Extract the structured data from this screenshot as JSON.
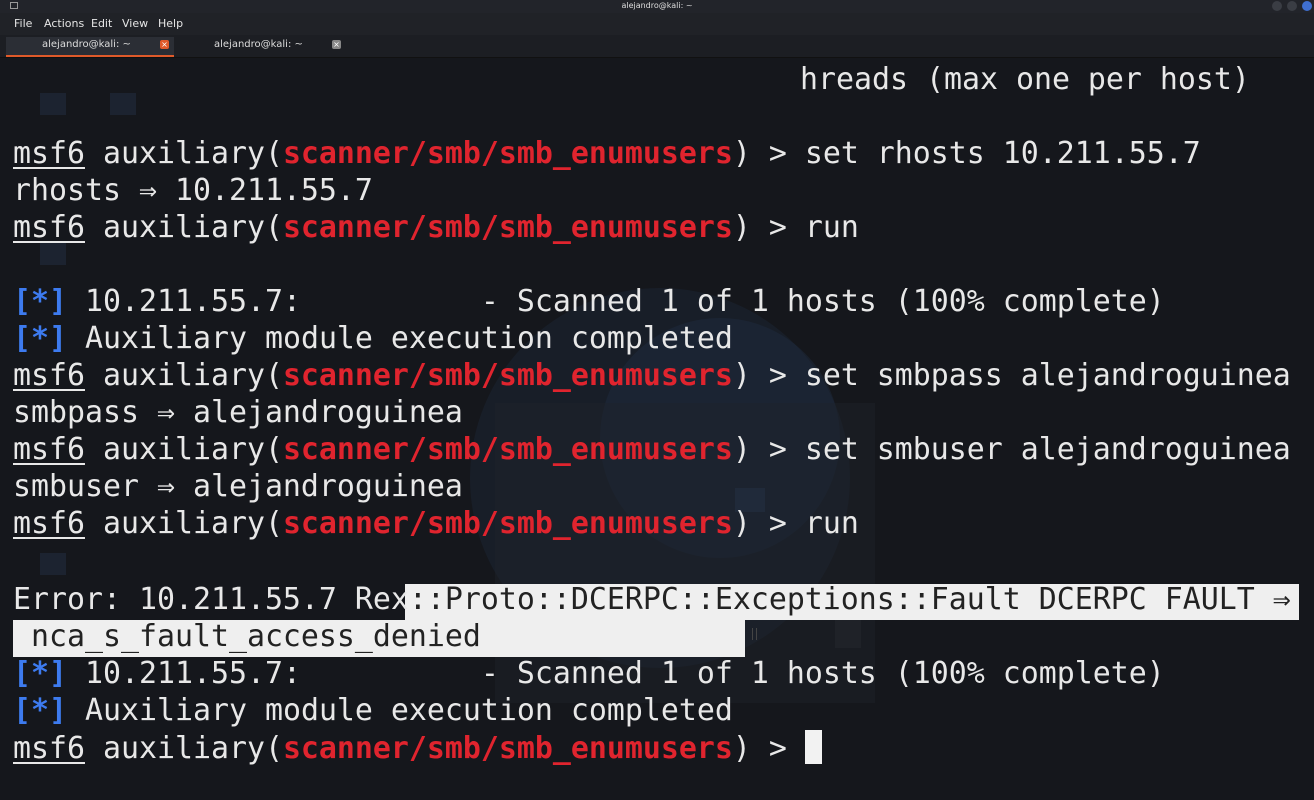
{
  "window": {
    "title": "alejandro@kali: ~"
  },
  "menu": {
    "file": "File",
    "actions": "Actions",
    "edit": "Edit",
    "view": "View",
    "help": "Help"
  },
  "tabs": [
    {
      "label": "alejandro@kali: ~"
    },
    {
      "label": "alejandro@kali: ~"
    }
  ],
  "terminal": {
    "line1": "hreads (max one per host)",
    "prompt_prefix": "msf6",
    "prompt_mid": " auxiliary(",
    "prompt_module": "scanner/smb/smb_enumusers",
    "prompt_end": ") > ",
    "cmd_set_rhosts": "set rhosts 10.211.55.7",
    "out_rhosts": "rhosts ⇒ 10.211.55.7",
    "cmd_run": "run",
    "status_marker": "[*]",
    "out_scanned": " 10.211.55.7:          - Scanned 1 of 1 hosts (100% complete)",
    "out_completed": " Auxiliary module execution completed",
    "cmd_set_smbpass": "set smbpass alejandroguinea",
    "out_smbpass": "smbpass ⇒ alejandroguinea",
    "cmd_set_smbuser": "set smbuser alejandroguinea",
    "out_smbuser": "smbuser ⇒ alejandroguinea",
    "error_prefix": "Error: 10.211.55.7 Rex",
    "error_selected_1": "::Proto::DCERPC::Exceptions::Fault DCERPC FAULT ⇒",
    "error_selected_2": " nca_s_fault_access_denied"
  },
  "colors": {
    "module_red": "#e0242e",
    "status_blue": "#3d7bf0",
    "tab_accent": "#e05a2a",
    "selection_bg": "#efefef"
  }
}
